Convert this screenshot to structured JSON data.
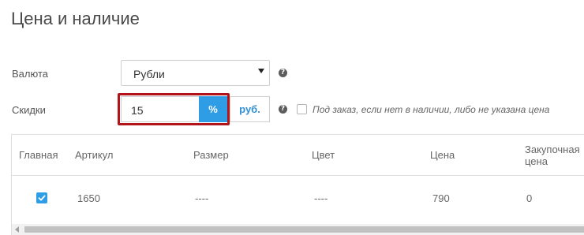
{
  "section": {
    "title": "Цена и наличие"
  },
  "currency": {
    "label": "Валюта",
    "selected": "Рубли"
  },
  "discount": {
    "label": "Скидки",
    "value": "15",
    "percent_label": "%",
    "rub_label": "руб.",
    "preorder_text": "Под заказ, если нет в наличии, либо не указана цена",
    "preorder_checked": false
  },
  "help": {
    "symbol": "?"
  },
  "table": {
    "headers": {
      "main": "Главная",
      "article": "Артикул",
      "size": "Размер",
      "color": "Цвет",
      "price": "Цена",
      "cost_line1": "Закупочная",
      "cost_line2": "цена"
    },
    "rows": [
      {
        "main_checked": true,
        "article": "1650",
        "size": "----",
        "color": "----",
        "price": "790",
        "cost": "0"
      }
    ]
  },
  "colors": {
    "accent": "#2e9de6",
    "highlight_border": "#b3141a"
  }
}
